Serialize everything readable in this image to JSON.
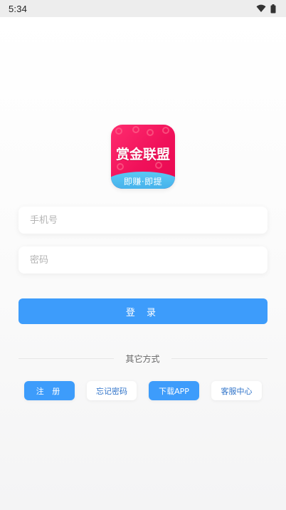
{
  "status_bar": {
    "time": "5:34",
    "icons": [
      "wifi-icon",
      "battery-icon"
    ]
  },
  "logo": {
    "title": "赏金联盟",
    "subtitle": "即赚·即提",
    "colors": {
      "primary": "#f0115a",
      "wave": "#3aa4e6"
    }
  },
  "form": {
    "phone_placeholder": "手机号",
    "password_placeholder": "密码",
    "login_label": "登 录"
  },
  "other_methods": {
    "label": "其它方式"
  },
  "actions": {
    "register_label": "注 册",
    "forgot_label": "忘记密码",
    "download_label": "下载APP",
    "support_label": "客服中心"
  },
  "colors": {
    "accent": "#3d9cfb",
    "link": "#2f73c9"
  }
}
